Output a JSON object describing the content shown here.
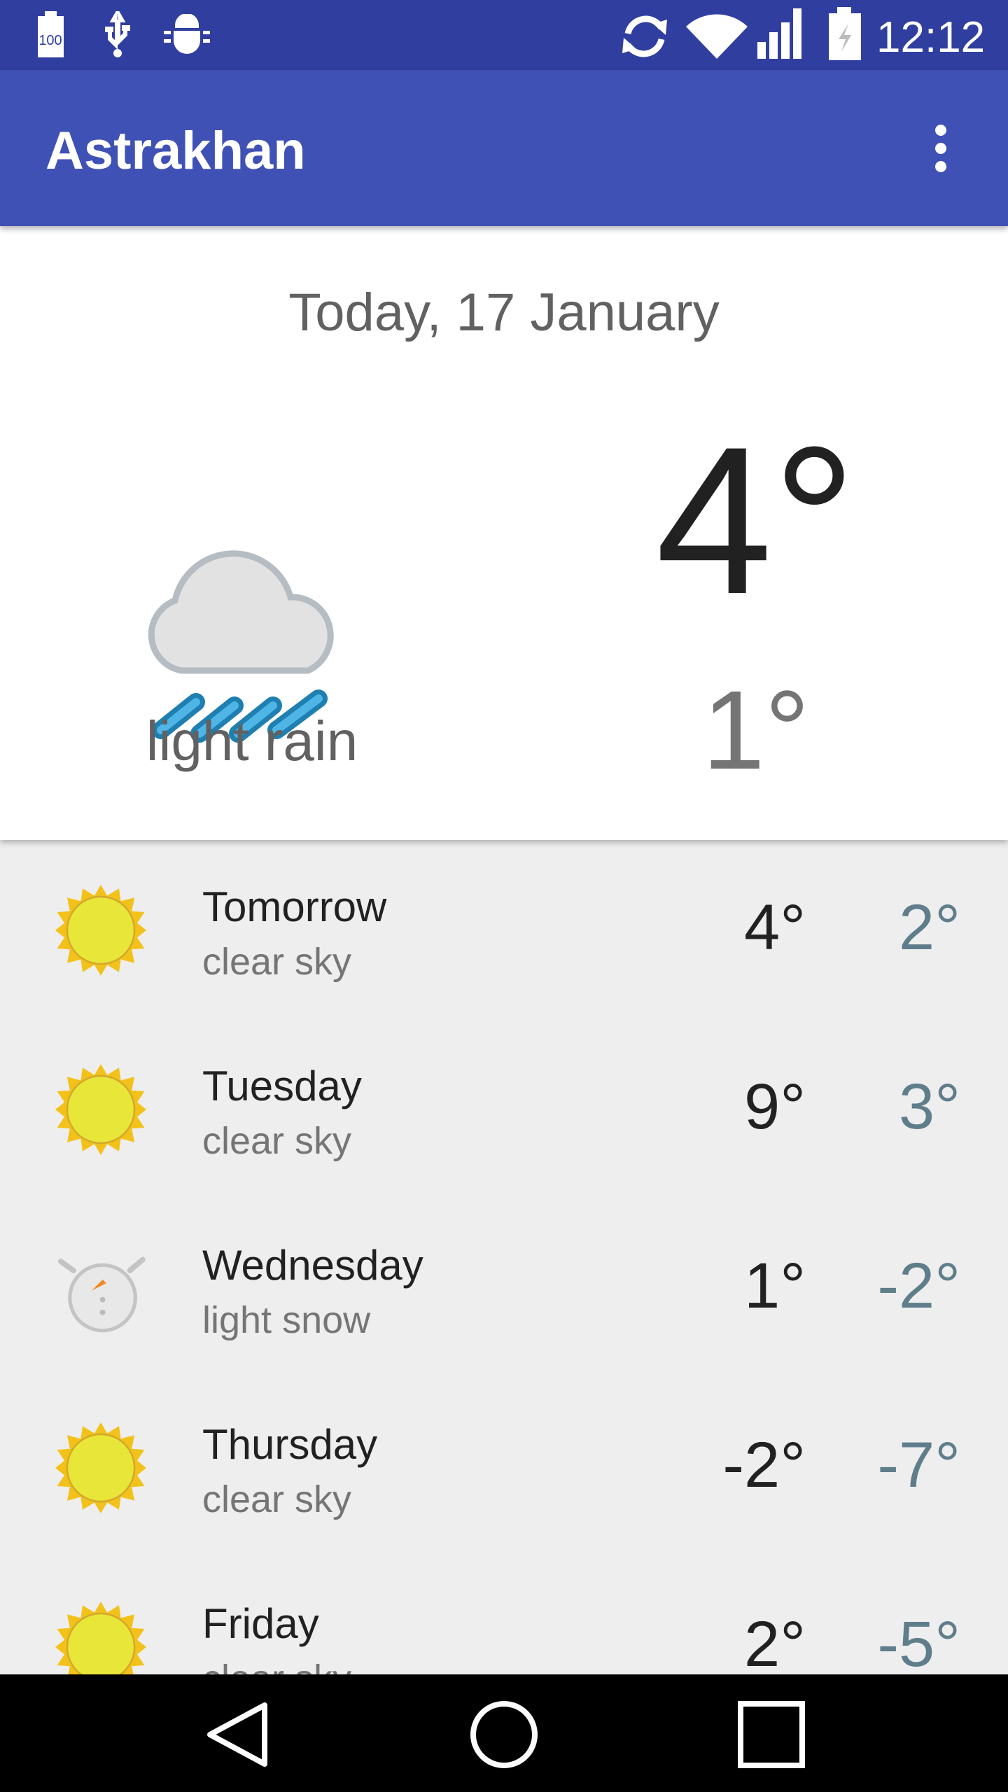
{
  "status_bar": {
    "time": "12:12",
    "battery_notice": "100",
    "icons": [
      "battery-100-icon",
      "usb-icon",
      "android-debug-icon",
      "sync-icon",
      "wifi-icon",
      "signal-icon",
      "battery-charging-icon"
    ]
  },
  "app_bar": {
    "title": "Astrakhan",
    "menu_icon": "more-vert-icon"
  },
  "today": {
    "date": "Today, 17 January",
    "high": "4°",
    "low": "1°",
    "description": "light rain",
    "icon": "light-rain-icon"
  },
  "forecast": [
    {
      "day": "Tomorrow",
      "description": "clear sky",
      "high": "4°",
      "low": "2°",
      "icon": "sun"
    },
    {
      "day": "Tuesday",
      "description": "clear sky",
      "high": "9°",
      "low": "3°",
      "icon": "sun"
    },
    {
      "day": "Wednesday",
      "description": "light snow",
      "high": "1°",
      "low": "-2°",
      "icon": "snow"
    },
    {
      "day": "Thursday",
      "description": "clear sky",
      "high": "-2°",
      "low": "-7°",
      "icon": "sun"
    },
    {
      "day": "Friday",
      "description": "clear sky",
      "high": "2°",
      "low": "-5°",
      "icon": "sun"
    }
  ],
  "colors": {
    "primary": "#3f51b5",
    "primary_dark": "#303f9f",
    "low_temp": "#607d8b"
  },
  "nav_bar": {
    "icons": [
      "back-icon",
      "home-icon",
      "recents-icon"
    ]
  }
}
